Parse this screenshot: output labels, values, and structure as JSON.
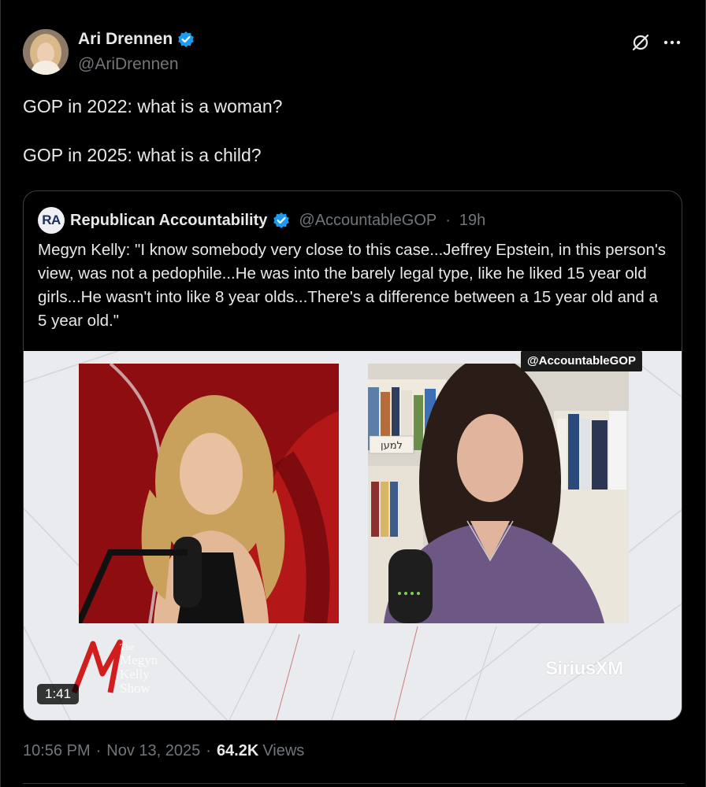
{
  "author": {
    "name": "Ari Drennen",
    "handle": "@AriDrennen",
    "avatar_icon": "profile-photo"
  },
  "tweet": {
    "lines": [
      "GOP in 2022: what is a woman?",
      "GOP in 2025: what is a child?"
    ]
  },
  "quoted": {
    "avatar_text": "RA",
    "name": "Republican Accountability",
    "handle": "@AccountableGOP",
    "separator": "·",
    "time": "19h",
    "text": "Megyn Kelly: \"I know somebody very close to this case...Jeffrey Epstein, in this person's view, was not a pedophile...He was into the barely legal type, like he liked 15 year old girls...He wasn't into like 8 year olds...There's a difference between a 15 year old and a 5 year old.\""
  },
  "video": {
    "watermark": "@AccountableGOP",
    "network": "SiriusXM",
    "show_logo": "The Megyn Kelly Show",
    "bookshelf_sign": "למען",
    "duration": "1:41"
  },
  "meta": {
    "time": "10:56 PM",
    "sep1": "·",
    "date": "Nov 13, 2025",
    "sep2": "·",
    "views_count": "64.2K",
    "views_label": "Views"
  },
  "colors": {
    "background": "#000000",
    "text": "#e7e9ea",
    "muted": "#71767b",
    "verified": "#1d9bf0",
    "border": "#2f3336"
  }
}
